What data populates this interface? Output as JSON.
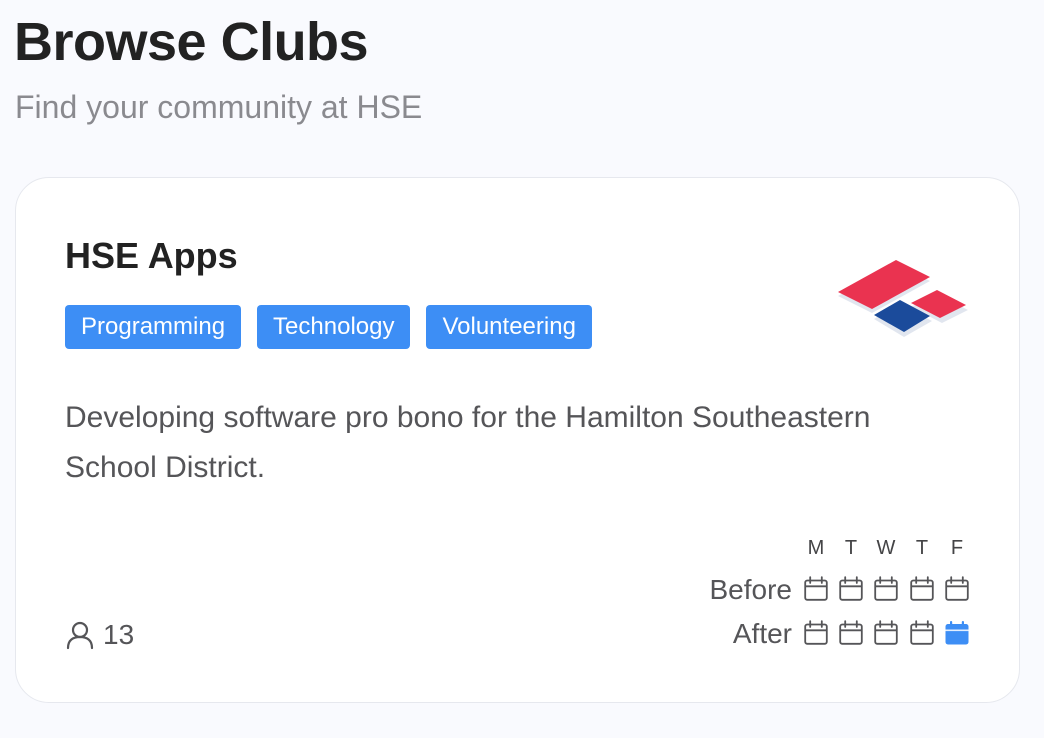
{
  "page": {
    "title": "Browse Clubs",
    "subtitle": "Find your community at HSE"
  },
  "club": {
    "name": "HSE Apps",
    "tags": [
      "Programming",
      "Technology",
      "Volunteering"
    ],
    "description": "Developing software pro bono for the Hamilton Southeastern School District.",
    "member_count": "13",
    "member_icon": "user-icon",
    "logo_icon": "club-logo",
    "schedule": {
      "days": [
        "M",
        "T",
        "W",
        "T",
        "F"
      ],
      "rows": [
        {
          "label": "Before",
          "active": [
            false,
            false,
            false,
            false,
            false
          ]
        },
        {
          "label": "After",
          "active": [
            false,
            false,
            false,
            false,
            true
          ]
        }
      ],
      "calendar_icon": "calendar-icon"
    }
  },
  "colors": {
    "accent": "#3d8ef5",
    "logo_red": "#ea3350",
    "logo_blue": "#1b4b9b",
    "inactive_icon": "#555558"
  }
}
